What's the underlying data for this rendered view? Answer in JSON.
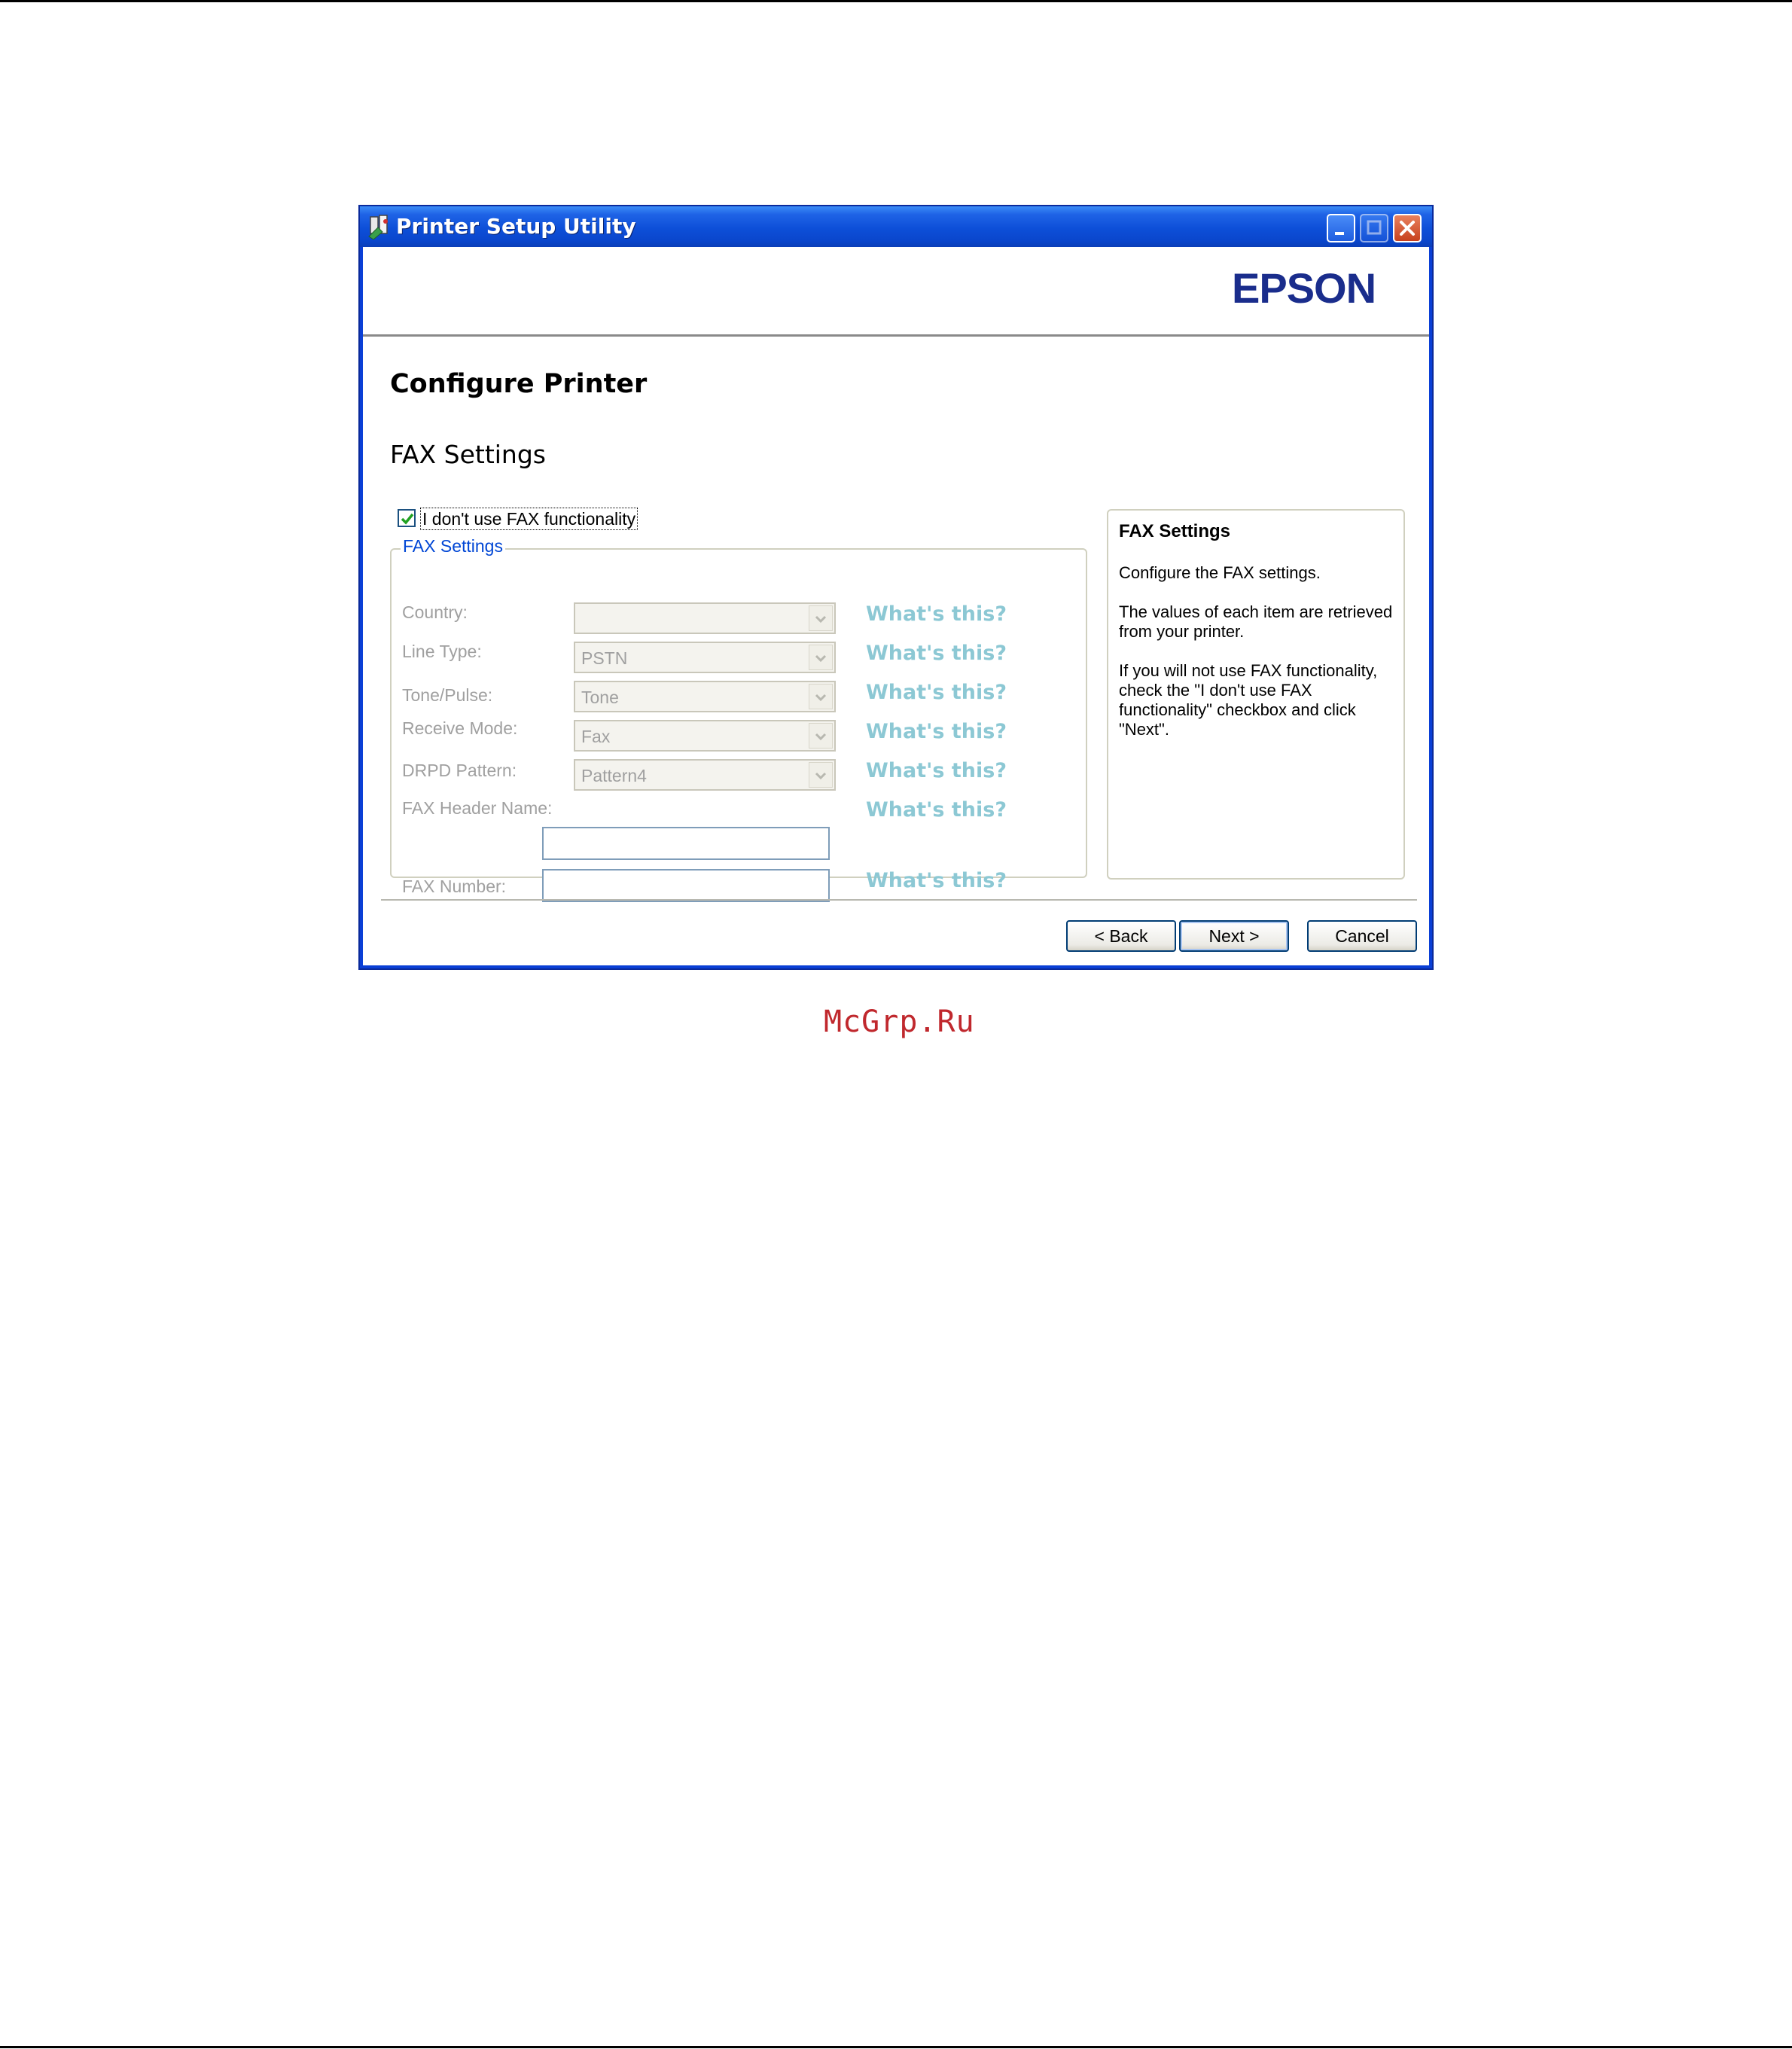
{
  "window": {
    "title": "Printer Setup Utility"
  },
  "brand": {
    "name": "EPSON",
    "color": "#1a2d8c"
  },
  "page": {
    "title": "Configure Printer",
    "section": "FAX Settings"
  },
  "checkbox": {
    "label": "I don't use FAX functionality",
    "checked": true
  },
  "group": {
    "legend": "FAX Settings",
    "fields": {
      "country": {
        "label": "Country:",
        "value": ""
      },
      "line_type": {
        "label": "Line Type:",
        "value": "PSTN"
      },
      "tone_pulse": {
        "label": "Tone/Pulse:",
        "value": "Tone"
      },
      "receive_mode": {
        "label": "Receive Mode:",
        "value": "Fax"
      },
      "drpd_pattern": {
        "label": "DRPD Pattern:",
        "value": "Pattern4"
      },
      "header_name": {
        "label": "FAX Header Name:",
        "value": ""
      },
      "fax_number": {
        "label": "FAX Number:",
        "value": ""
      }
    },
    "help_link": "What's this?"
  },
  "help_panel": {
    "title": "FAX Settings",
    "paragraphs": [
      "Configure the FAX settings.",
      "The values of each item are retrieved from your printer.",
      "If you will not use FAX functionality, check the \"I don't use FAX functionality\" checkbox and click \"Next\"."
    ]
  },
  "buttons": {
    "back": "< Back",
    "next": "Next >",
    "cancel": "Cancel"
  },
  "watermark": "McGrp.Ru",
  "colors": {
    "disabled_text": "#a0a0a0",
    "link": "#8cc8d4",
    "titlebar": "#0d4fd8"
  }
}
